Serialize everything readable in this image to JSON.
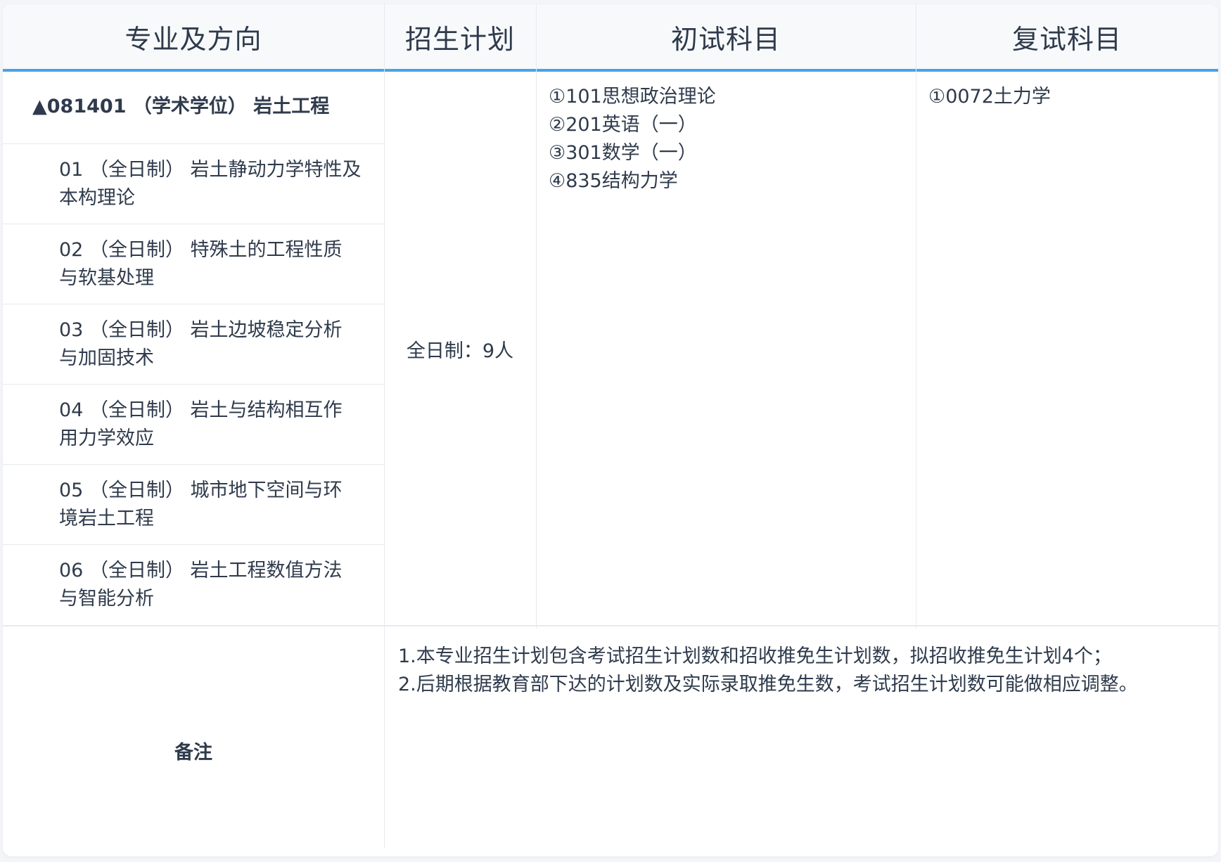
{
  "table": {
    "headers": [
      "专业及方向",
      "招生计划",
      "初试科目",
      "复试科目"
    ],
    "major": {
      "title": "▲081401 （学术学位） 岩土工程"
    },
    "directions": [
      {
        "line1": "01 （全日制） 岩土静动力学特性及",
        "line2": "本构理论"
      },
      {
        "line1": "02 （全日制） 特殊土的工程性质",
        "line2": "与软基处理"
      },
      {
        "line1": "03 （全日制） 岩土边坡稳定分析",
        "line2": "与加固技术"
      },
      {
        "line1": "04 （全日制） 岩土与结构相互作",
        "line2": "用力学效应"
      },
      {
        "line1": "05 （全日制） 城市地下空间与环",
        "line2": "境岩土工程"
      },
      {
        "line1": "06 （全日制） 岩土工程数值方法",
        "line2": "与智能分析"
      }
    ],
    "plan": "全日制：9人",
    "initial_exam": [
      "①101思想政治理论",
      "②201英语（一）",
      "③301数学（一）",
      "④835结构力学"
    ],
    "retest_exam": [
      "①0072土力学"
    ],
    "remark_label": "备注",
    "remarks": [
      "1.本专业招生计划包含考试招生计划数和招收推免生计划数，拟招收推免生计划4个；",
      "2.后期根据教育部下达的计划数及实际录取推免生数，考试招生计划数可能做相应调整。"
    ]
  },
  "colors": {
    "accent": "#4aa3e6",
    "header_bg": "#f7f9fb",
    "border": "#e6eaef",
    "text": "#2f3b4c"
  }
}
